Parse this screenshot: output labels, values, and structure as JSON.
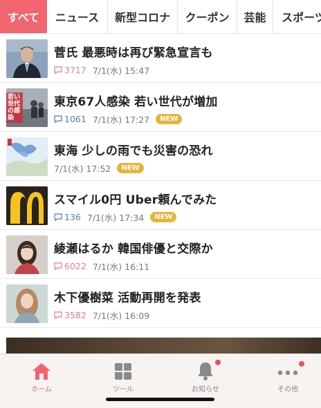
{
  "tabs": [
    {
      "label": "すべて",
      "active": true
    },
    {
      "label": "ニュース"
    },
    {
      "label": "新型コロナ"
    },
    {
      "label": "クーポン"
    },
    {
      "label": "芸能"
    },
    {
      "label": "スポーツ"
    }
  ],
  "articles": [
    {
      "title": "菅氏 最悪時は再び緊急宣言も",
      "comments": "3717",
      "date": "7/1(水) 15:47",
      "new": ""
    },
    {
      "title": "東京67人感染 若い世代が増加",
      "comments": "1061",
      "date": "7/1(水) 17:27",
      "new": "NEW",
      "thumb_text": "若い世代の感染"
    },
    {
      "title": "東海 少しの雨でも災害の恐れ",
      "comments": "",
      "date": "7/1(水) 17:52",
      "new": "NEW"
    },
    {
      "title": "スマイル0円 Uber頼んでみた",
      "comments": "136",
      "date": "7/1(水) 17:34",
      "new": "NEW"
    },
    {
      "title": "綾瀬はるか 韓国俳優と交際か",
      "comments": "6022",
      "date": "7/1(水) 16:11",
      "new": ""
    },
    {
      "title": "木下優樹菜 活動再開を発表",
      "comments": "3582",
      "date": "7/1(水) 16:09",
      "new": ""
    }
  ],
  "bottom_nav": {
    "home": "ホーム",
    "tools": "ツール",
    "notifications": "お知らせ",
    "other": "その他"
  },
  "colors": {
    "accent": "#f0656e",
    "new_badge": "#e6b437",
    "comment_blue": "#4a7fb5",
    "comment_red": "#e87a86"
  }
}
